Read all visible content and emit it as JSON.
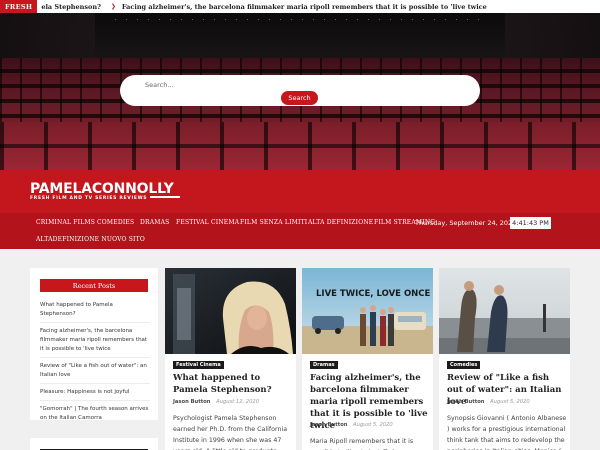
{
  "ticker": {
    "label": "FRESH",
    "items": [
      "ela Stephenson?",
      "Facing alzheimer's, the barcelona filmmaker maria ripoll remembers that it is possible to 'live twice"
    ]
  },
  "search": {
    "placeholder": "Search...",
    "button": "Search"
  },
  "brand": {
    "title": "PAMELACONNOLLY",
    "tagline": "FRESH FILM AND TV SERIES REVIEWS",
    "accent_color": "#c8161d"
  },
  "nav": {
    "items": [
      "CRIMINAL FILMS",
      "COMEDIES",
      "DRAMAS",
      "FESTIVAL CINEMA",
      "FILM SENZA LIMITI",
      "ALTA DEFINIZIONE",
      "FILM STREAMING",
      "ALTADEFINIZIONE NUOVO SITO"
    ],
    "date": "Thursday, September 24, 2020",
    "time": "4:41:43 PM"
  },
  "sidebar": {
    "title": "Recent Posts",
    "items": [
      "What happened to Pamela Stephenson?",
      "Facing alzheimer's, the barcelona filmmaker maria ripoll remembers that it is possible to 'live twice",
      "Review of \"Like a fish out of water\": an Italian love",
      "Pleasure: Happiness is not joyful",
      "\"Gomorrah\" | The fourth season arrives on the Italian Camorra"
    ]
  },
  "posts": [
    {
      "category": "Festival Cinema",
      "title": "What happened to Pamela Stephenson?",
      "author": "Jason Button",
      "date": "August 12, 2020",
      "excerpt": "Psychologist Pamela Stephenson earned her Ph.D. from the California Institute in 1996 when she was 47 years old. A little old to graduate"
    },
    {
      "category": "Dramas",
      "title": "Facing alzheimer's, the barcelona filmmaker maria ripoll remembers that it is possible to 'live twice",
      "author": "Jason Button",
      "date": "August 5, 2020",
      "excerpt": "Maria Ripoll remembers that it is possible to 'live twice'. Today",
      "image_text": "LIVE TWICE, LOVE ONCE"
    },
    {
      "category": "Comedies",
      "title": "Review of \"Like a fish out of water\": an Italian love",
      "author": "Jason Button",
      "date": "August 5, 2020",
      "excerpt": "Synopsis Giovanni ( Antonio Albanese ) works for a prestigious international think tank that aims to redevelop the peripheries in Italian cities. Monica ("
    }
  ]
}
